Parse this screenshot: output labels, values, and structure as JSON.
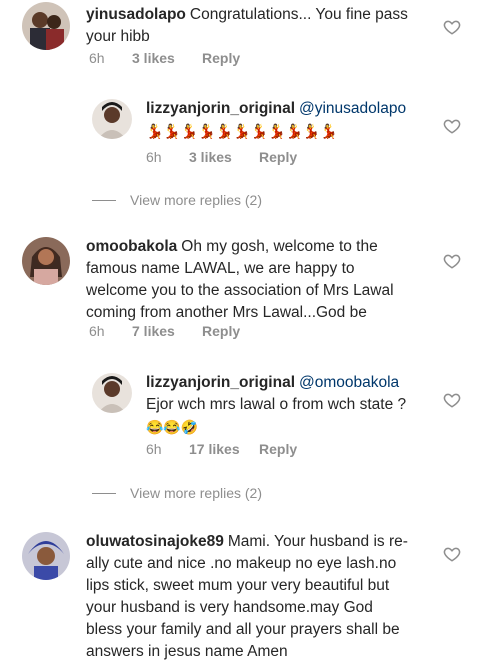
{
  "heart_icon": "heart-outline-icon",
  "colors": {
    "text": "#262626",
    "muted": "#8e8e8e",
    "mention": "#00376b"
  },
  "comments": [
    {
      "username": "yinusadolapo",
      "text_line1": "Congratulations... You fine pass",
      "text_line2": "your hibb",
      "time": "6h",
      "likes": "3 likes",
      "reply": "Reply"
    },
    {
      "username": "lizzyanjorin_original",
      "mention": "@yinusadolapo",
      "emoji_line": "💃💃💃💃💃💃💃💃💃💃💃",
      "time": "6h",
      "likes": "3 likes",
      "reply": "Reply"
    },
    {
      "view_more": "View more replies (2)"
    },
    {
      "username": "omoobakola",
      "text_line1": "Oh my gosh, welcome to the",
      "text_line2": "famous name LAWAL, we are happy to",
      "text_line3": "welcome you to the association of Mrs Lawal",
      "text_line4": "coming from another Mrs Lawal...God be",
      "time": "6h",
      "likes": "7 likes",
      "reply": "Reply"
    },
    {
      "username": "lizzyanjorin_original",
      "mention": "@omoobakola",
      "text_line2": "Ejor wch mrs lawal o from wch state ?",
      "emoji_line": "😂😂🤣",
      "time": "6h",
      "likes": "17 likes",
      "reply": "Reply"
    },
    {
      "view_more": "View more replies (2)"
    },
    {
      "username": "oluwatosinajoke89",
      "text_line1": "Mami. Your husband is re-",
      "text_line2": "ally cute and nice .no makeup no eye lash.no",
      "text_line3": "lips stick, sweet mum your very beautiful but",
      "text_line4": "your husband is very handsome.may God",
      "text_line5": "bless your family and all your prayers shall be",
      "text_line6": "answers in jesus name Amen"
    }
  ]
}
